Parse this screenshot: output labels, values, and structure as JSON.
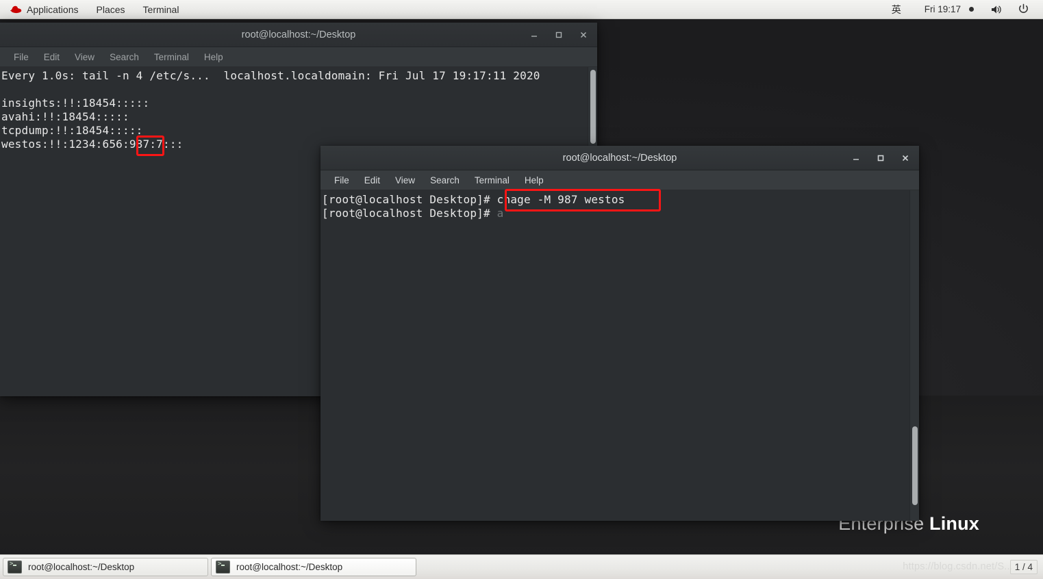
{
  "top_panel": {
    "logo_name": "redhat-logo",
    "items": [
      {
        "label": "Applications"
      },
      {
        "label": "Places"
      },
      {
        "label": "Terminal"
      }
    ],
    "ime_label": "英",
    "clock": "Fri 19:17",
    "volume_icon": "speaker-icon",
    "power_icon": "power-icon"
  },
  "wallpaper": {
    "brand_thin": "Enterprise",
    "brand_bold": "Linux"
  },
  "window_back": {
    "title": "root@localhost:~/Desktop",
    "menus": [
      "File",
      "Edit",
      "View",
      "Search",
      "Terminal",
      "Help"
    ],
    "buttons": {
      "minimize": "minimize-button",
      "maximize": "maximize-button",
      "close": "close-button"
    },
    "content": "Every 1.0s: tail -n 4 /etc/s...  localhost.localdomain: Fri Jul 17 19:17:11 2020\n\ninsights:!!:18454:::::\navahi:!!:18454:::::\ntcpdump:!!:18454:::::\nwestos:!!:1234:656:987:7:::",
    "annotation_label": "987"
  },
  "window_front": {
    "title": "root@localhost:~/Desktop",
    "menus": [
      "File",
      "Edit",
      "View",
      "Search",
      "Terminal",
      "Help"
    ],
    "buttons": {
      "minimize": "minimize-button",
      "maximize": "maximize-button",
      "close": "close-button"
    },
    "line1_prompt": "[root@localhost Desktop]# ",
    "line1_command": "chage -M 987 westos",
    "line2_prompt": "[root@localhost Desktop]# ",
    "line2_cursor": "a",
    "annotation_label": "chage -M 987 westos"
  },
  "taskbar": {
    "tasks": [
      {
        "label": "root@localhost:~/Desktop",
        "icon": "terminal-icon",
        "active": false
      },
      {
        "label": "root@localhost:~/Desktop",
        "icon": "terminal-icon",
        "active": true
      }
    ],
    "watermark": "https://blog.csdn.net/S...",
    "page_counter": "1 / 4"
  },
  "colors": {
    "annotation_red": "#fb1515",
    "panel_bg": "#ebebe9",
    "terminal_bg": "#2b2e31",
    "terminal_fg": "#e8e8e8"
  }
}
